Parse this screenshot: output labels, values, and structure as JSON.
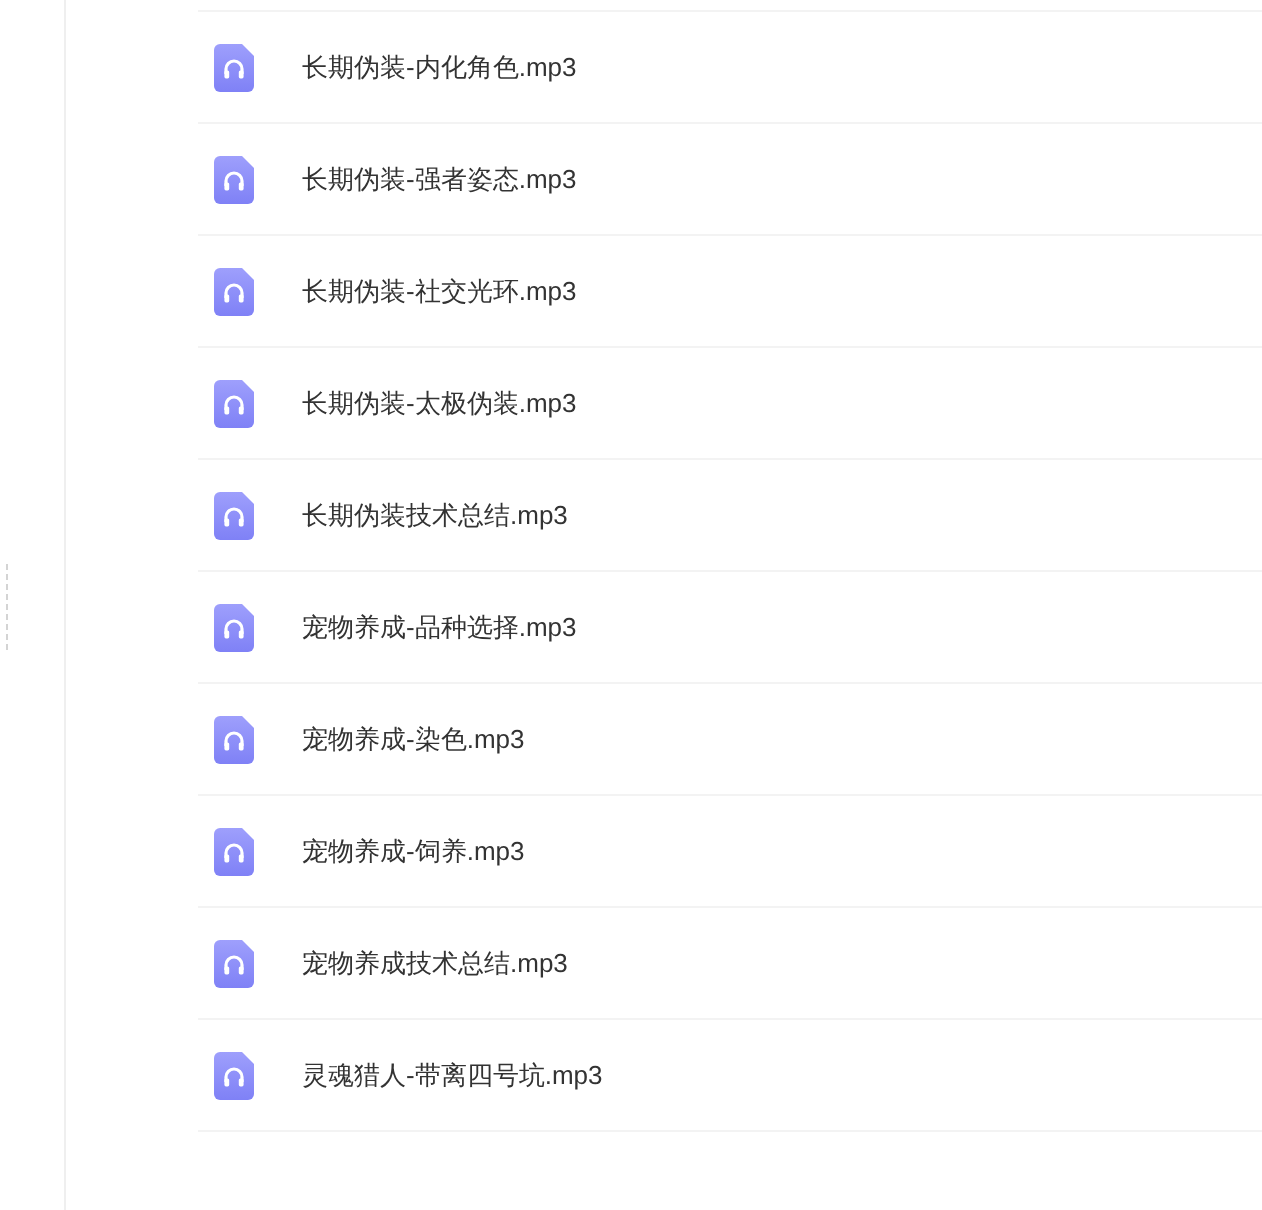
{
  "files": [
    {
      "name": "长期伪装-内化角色.mp3"
    },
    {
      "name": "长期伪装-强者姿态.mp3"
    },
    {
      "name": "长期伪装-社交光环.mp3"
    },
    {
      "name": "长期伪装-太极伪装.mp3"
    },
    {
      "name": "长期伪装技术总结.mp3"
    },
    {
      "name": "宠物养成-品种选择.mp3"
    },
    {
      "name": "宠物养成-染色.mp3"
    },
    {
      "name": "宠物养成-饲养.mp3"
    },
    {
      "name": "宠物养成技术总结.mp3"
    },
    {
      "name": "灵魂猎人-带离四号坑.mp3"
    }
  ]
}
